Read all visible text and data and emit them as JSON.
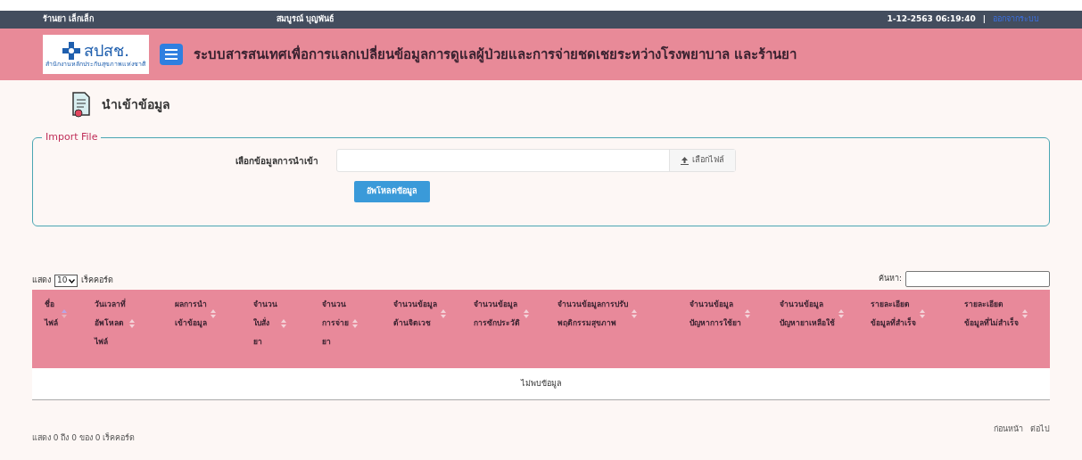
{
  "top_bar": {
    "store": "ร้านยา เล็กเล็ก",
    "user": "สมบูรณ์ บุญพันธ์",
    "datetime": "1-12-2563 06:19:40",
    "separator": "|",
    "link": "ออกจากระบบ"
  },
  "header": {
    "logo_text": "สปสช.",
    "logo_subtitle": "สำนักงานหลักประกันสุขภาพแห่งชาติ",
    "title": "ระบบสารสนเทศเพื่อการแลกเปลี่ยนข้อมูลการดูแลผู้ป่วยและการจ่ายชดเชยระหว่างโรงพยาบาล และร้านยา"
  },
  "page_title": "นำเข้าข้อมูล",
  "import": {
    "legend": "Import File",
    "label": "เลือกข้อมูลการนำเข้า",
    "browse_button": "เลือกไฟล์",
    "upload_button": "อัพโหลดข้อมูล"
  },
  "table_controls": {
    "show_prefix": "แสดง",
    "page_size": "10",
    "show_suffix": "เร็คคอร์ด",
    "search_label": "ค้นหา:"
  },
  "table": {
    "columns": [
      {
        "lines": [
          "ชื่อ",
          "ไฟล์"
        ],
        "sorted": true
      },
      {
        "lines": [
          "วันเวลาที่",
          "อัพโหลด",
          "ไฟล์"
        ],
        "sorted": false
      },
      {
        "lines": [
          "ผลการนำ",
          "เข้าข้อมูล"
        ],
        "sorted": false
      },
      {
        "lines": [
          "จำนวน",
          "ใบสั่ง",
          "ยา"
        ],
        "sorted": false
      },
      {
        "lines": [
          "จำนวน",
          "การจ่าย",
          "ยา"
        ],
        "sorted": false
      },
      {
        "lines": [
          "จำนวนข้อมูล",
          "ด้านจิตเวช"
        ],
        "sorted": false
      },
      {
        "lines": [
          "จำนวนข้อมูล",
          "การซักประวัติ"
        ],
        "sorted": false
      },
      {
        "lines": [
          "จำนวนข้อมูลการปรับ",
          "พฤติกรรมสุขภาพ"
        ],
        "sorted": false
      },
      {
        "lines": [
          "จำนวนข้อมูล",
          "ปัญหาการใช้ยา"
        ],
        "sorted": false
      },
      {
        "lines": [
          "จำนวนข้อมูล",
          "ปัญหายาเหลือใช้"
        ],
        "sorted": false
      },
      {
        "lines": [
          "รายละเอียด",
          "ข้อมูลที่สำเร็จ"
        ],
        "sorted": false
      },
      {
        "lines": [
          "รายละเอียด",
          "ข้อมูลที่ไม่สำเร็จ"
        ],
        "sorted": false
      }
    ],
    "empty_message": "ไม่พบข้อมูล"
  },
  "footer": {
    "info": "แสดง 0 ถึง 0 ของ 0 เร็คคอร์ด",
    "previous": "ก่อนหน้า",
    "next": "ต่อไป"
  }
}
